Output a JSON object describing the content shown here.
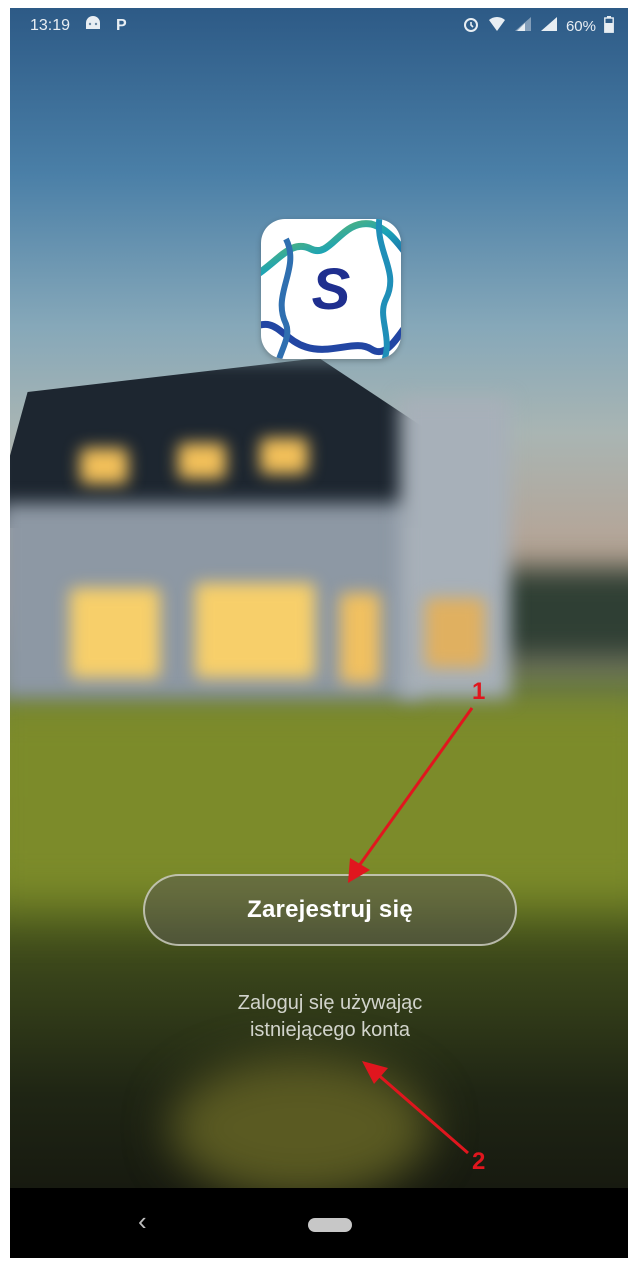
{
  "status_bar": {
    "time": "13:19",
    "battery": "60%",
    "icons": [
      "android-robot-icon",
      "parking-icon",
      "alarm-icon",
      "wifi-icon",
      "signal-icon",
      "signal-icon",
      "battery-icon"
    ]
  },
  "app": {
    "logo_letter": "S"
  },
  "actions": {
    "register_label": "Zarejestruj się",
    "login_line1": "Zaloguj się używając",
    "login_line2": "istniejącego konta"
  },
  "annotations": {
    "marker_1": "1",
    "marker_2": "2",
    "color": "#e0161e"
  },
  "navigation": {
    "back_glyph": "‹"
  }
}
